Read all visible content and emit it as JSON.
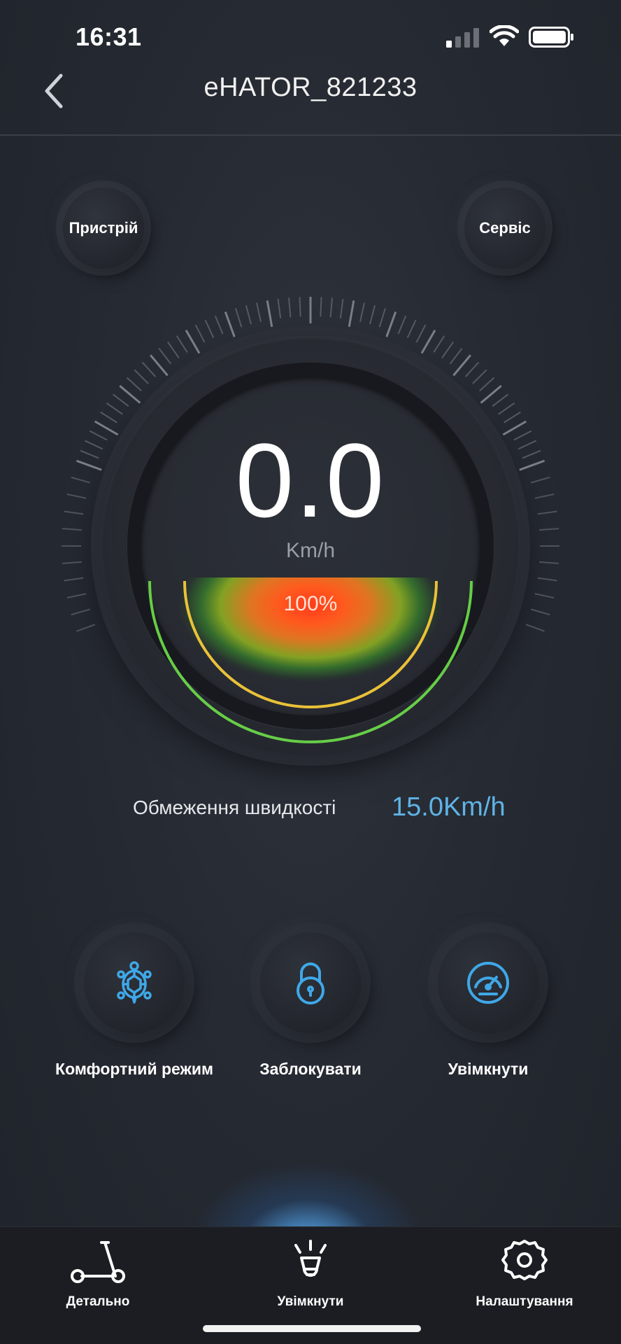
{
  "status_bar": {
    "time": "16:31"
  },
  "nav": {
    "title": "eHATOR_821233"
  },
  "corner_buttons": {
    "device_label": "Пристрій",
    "service_label": "Сервіс"
  },
  "gauge": {
    "speed": "0.0",
    "unit": "Km/h",
    "battery_percent": "100%",
    "battery_level": 1.0
  },
  "speed_limit": {
    "label": "Обмеження швидкості",
    "value": "15.0Km/h"
  },
  "actions": [
    {
      "label": "Комфортний режим",
      "icon": "turtle-icon"
    },
    {
      "label": "Заблокувати",
      "icon": "lock-icon"
    },
    {
      "label": "Увімкнути",
      "icon": "speedometer-icon"
    }
  ],
  "tabs": [
    {
      "label": "Детально",
      "icon": "scooter-icon"
    },
    {
      "label": "Увімкнути",
      "icon": "headlight-icon"
    },
    {
      "label": "Налаштування",
      "icon": "gear-icon"
    }
  ],
  "colors": {
    "accent_blue": "#5fb3e6",
    "icon_blue": "#3fa8e8",
    "background": "#22262e",
    "tab_bar": "#1b1d22",
    "gauge_red": "#ff3b1a",
    "gauge_green": "#4cc43a"
  }
}
